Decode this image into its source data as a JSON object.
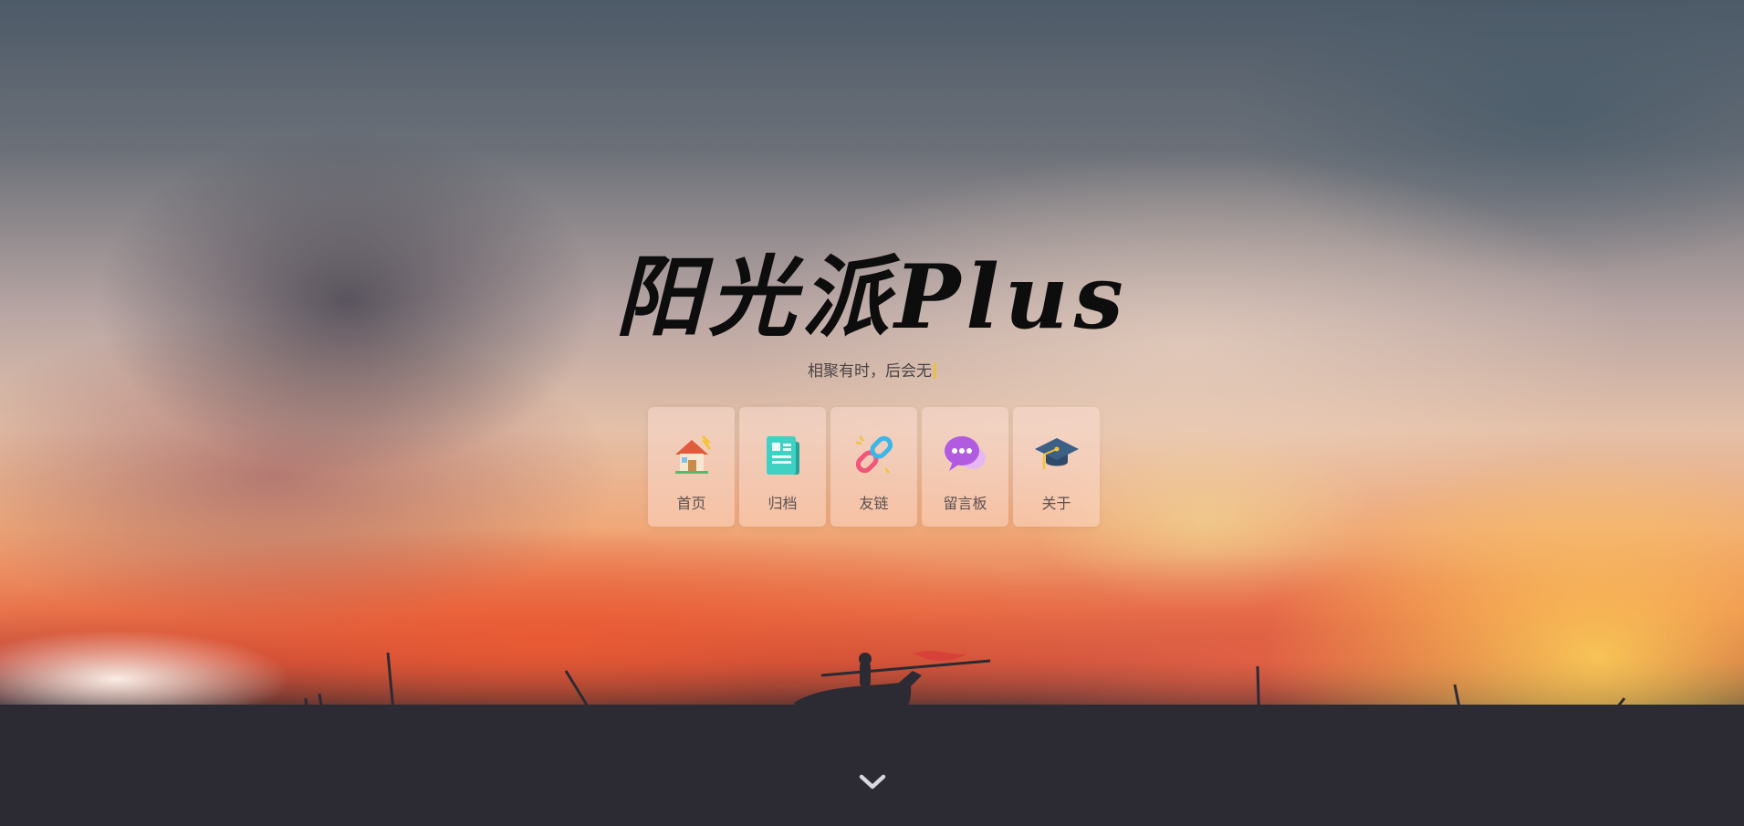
{
  "header": {
    "title": "阳光派Plus",
    "subtitle": "相聚有时，后会无"
  },
  "nav": {
    "items": [
      {
        "label": "首页",
        "icon": "home-icon"
      },
      {
        "label": "归档",
        "icon": "archive-icon"
      },
      {
        "label": "友链",
        "icon": "link-icon"
      },
      {
        "label": "留言板",
        "icon": "message-board-icon"
      },
      {
        "label": "关于",
        "icon": "graduation-cap-icon"
      }
    ]
  },
  "scroll_hint": {
    "icon": "chevron-down-icon"
  },
  "colors": {
    "title": "#0d0d0d",
    "subtitle": "#4a4444",
    "tile_bg": "rgba(255,225,215,0.45)",
    "ground": "#2c2a33"
  }
}
